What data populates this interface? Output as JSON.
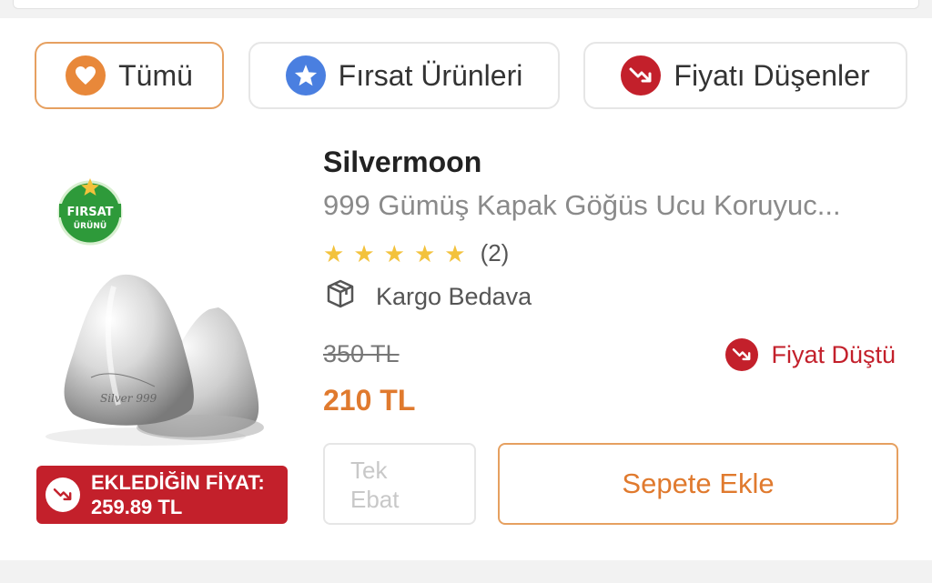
{
  "filters": [
    {
      "label": "Tümü",
      "icon": "heart-icon",
      "active": true
    },
    {
      "label": "Fırsat Ürünleri",
      "icon": "star-icon",
      "active": false
    },
    {
      "label": "Fiyatı Düşenler",
      "icon": "trend-down-icon",
      "active": false
    }
  ],
  "product": {
    "badge": {
      "line1": "FIRSAT",
      "line2": "ÜRÜNÜ"
    },
    "brand": "Silvermoon",
    "name": "999 Gümüş Kapak Göğüs Ucu Koruyuc...",
    "rating": {
      "stars": 5,
      "count": "(2)"
    },
    "shipping": "Kargo Bedava",
    "old_price": "350 TL",
    "price": "210 TL",
    "price_drop_label": "Fiyat Düştü",
    "added_price": {
      "line1": "EKLEDİĞİN FİYAT:",
      "line2": "259.89 TL"
    },
    "size": {
      "line1": "Tek",
      "line2": "Ebat"
    },
    "add_to_cart": "Sepete Ekle"
  },
  "colors": {
    "accent_orange": "#e07a2e",
    "orange_border": "#e6a060",
    "red": "#c3202b",
    "blue": "#4a7fe0",
    "star": "#f3c23c",
    "badge_green": "#2e9a3a"
  }
}
